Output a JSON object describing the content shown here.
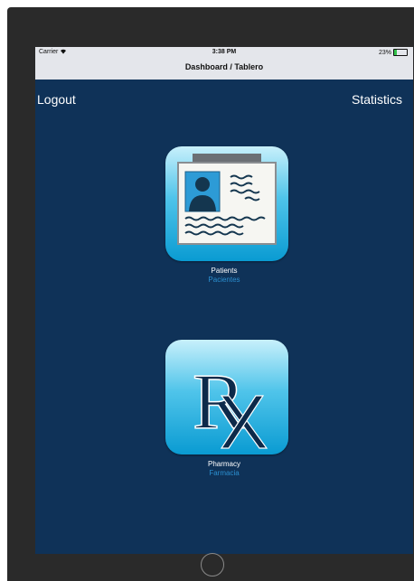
{
  "status_bar": {
    "carrier": "Carrier",
    "time": "3:38 PM",
    "battery_percent_text": "23%",
    "battery_level": 0.23
  },
  "nav": {
    "title": "Dashboard / Tablero",
    "left_button": "Logout",
    "right_button": "Statistics"
  },
  "tiles": [
    {
      "label": "Patients",
      "sublabel": "Pacientes",
      "icon": "patient-id-card-icon"
    },
    {
      "label": "Pharmacy",
      "sublabel": "Farmacia",
      "icon": "rx-icon"
    }
  ],
  "rx_glyph": "R",
  "colors": {
    "background": "#0f3258",
    "status_bar": "#e4e6eb",
    "label_primary": "#ffffff",
    "label_secondary": "#2b8fd0",
    "tile_gradient_top": "#c8f0fb",
    "tile_gradient_bottom": "#0a9bd2"
  }
}
